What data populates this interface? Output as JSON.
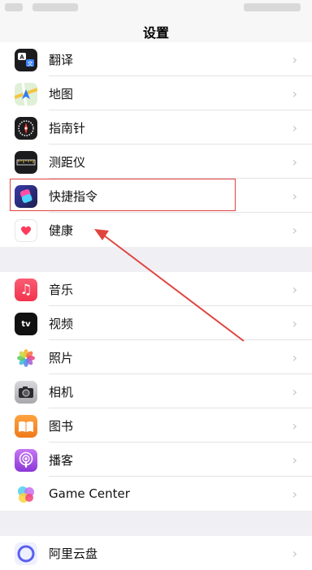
{
  "header": {
    "title": "设置"
  },
  "groups": [
    {
      "items": [
        {
          "label": "翻译",
          "icon": "translate-icon"
        },
        {
          "label": "地图",
          "icon": "maps-icon"
        },
        {
          "label": "指南针",
          "icon": "compass-icon"
        },
        {
          "label": "测距仪",
          "icon": "measure-icon"
        },
        {
          "label": "快捷指令",
          "icon": "shortcuts-icon"
        },
        {
          "label": "健康",
          "icon": "health-icon"
        }
      ]
    },
    {
      "items": [
        {
          "label": "音乐",
          "icon": "music-icon"
        },
        {
          "label": "视频",
          "icon": "tv-icon"
        },
        {
          "label": "照片",
          "icon": "photos-icon"
        },
        {
          "label": "相机",
          "icon": "camera-icon"
        },
        {
          "label": "图书",
          "icon": "books-icon"
        },
        {
          "label": "播客",
          "icon": "podcasts-icon"
        },
        {
          "label": "Game Center",
          "icon": "game-center-icon"
        }
      ]
    },
    {
      "items": [
        {
          "label": "阿里云盘",
          "icon": "aliyun-drive-icon"
        }
      ]
    }
  ],
  "colors": {
    "highlight": "#e0443e",
    "arrow": "#e0443e",
    "chevron": "#c4c4c7"
  },
  "tv_icon_text": "tv"
}
